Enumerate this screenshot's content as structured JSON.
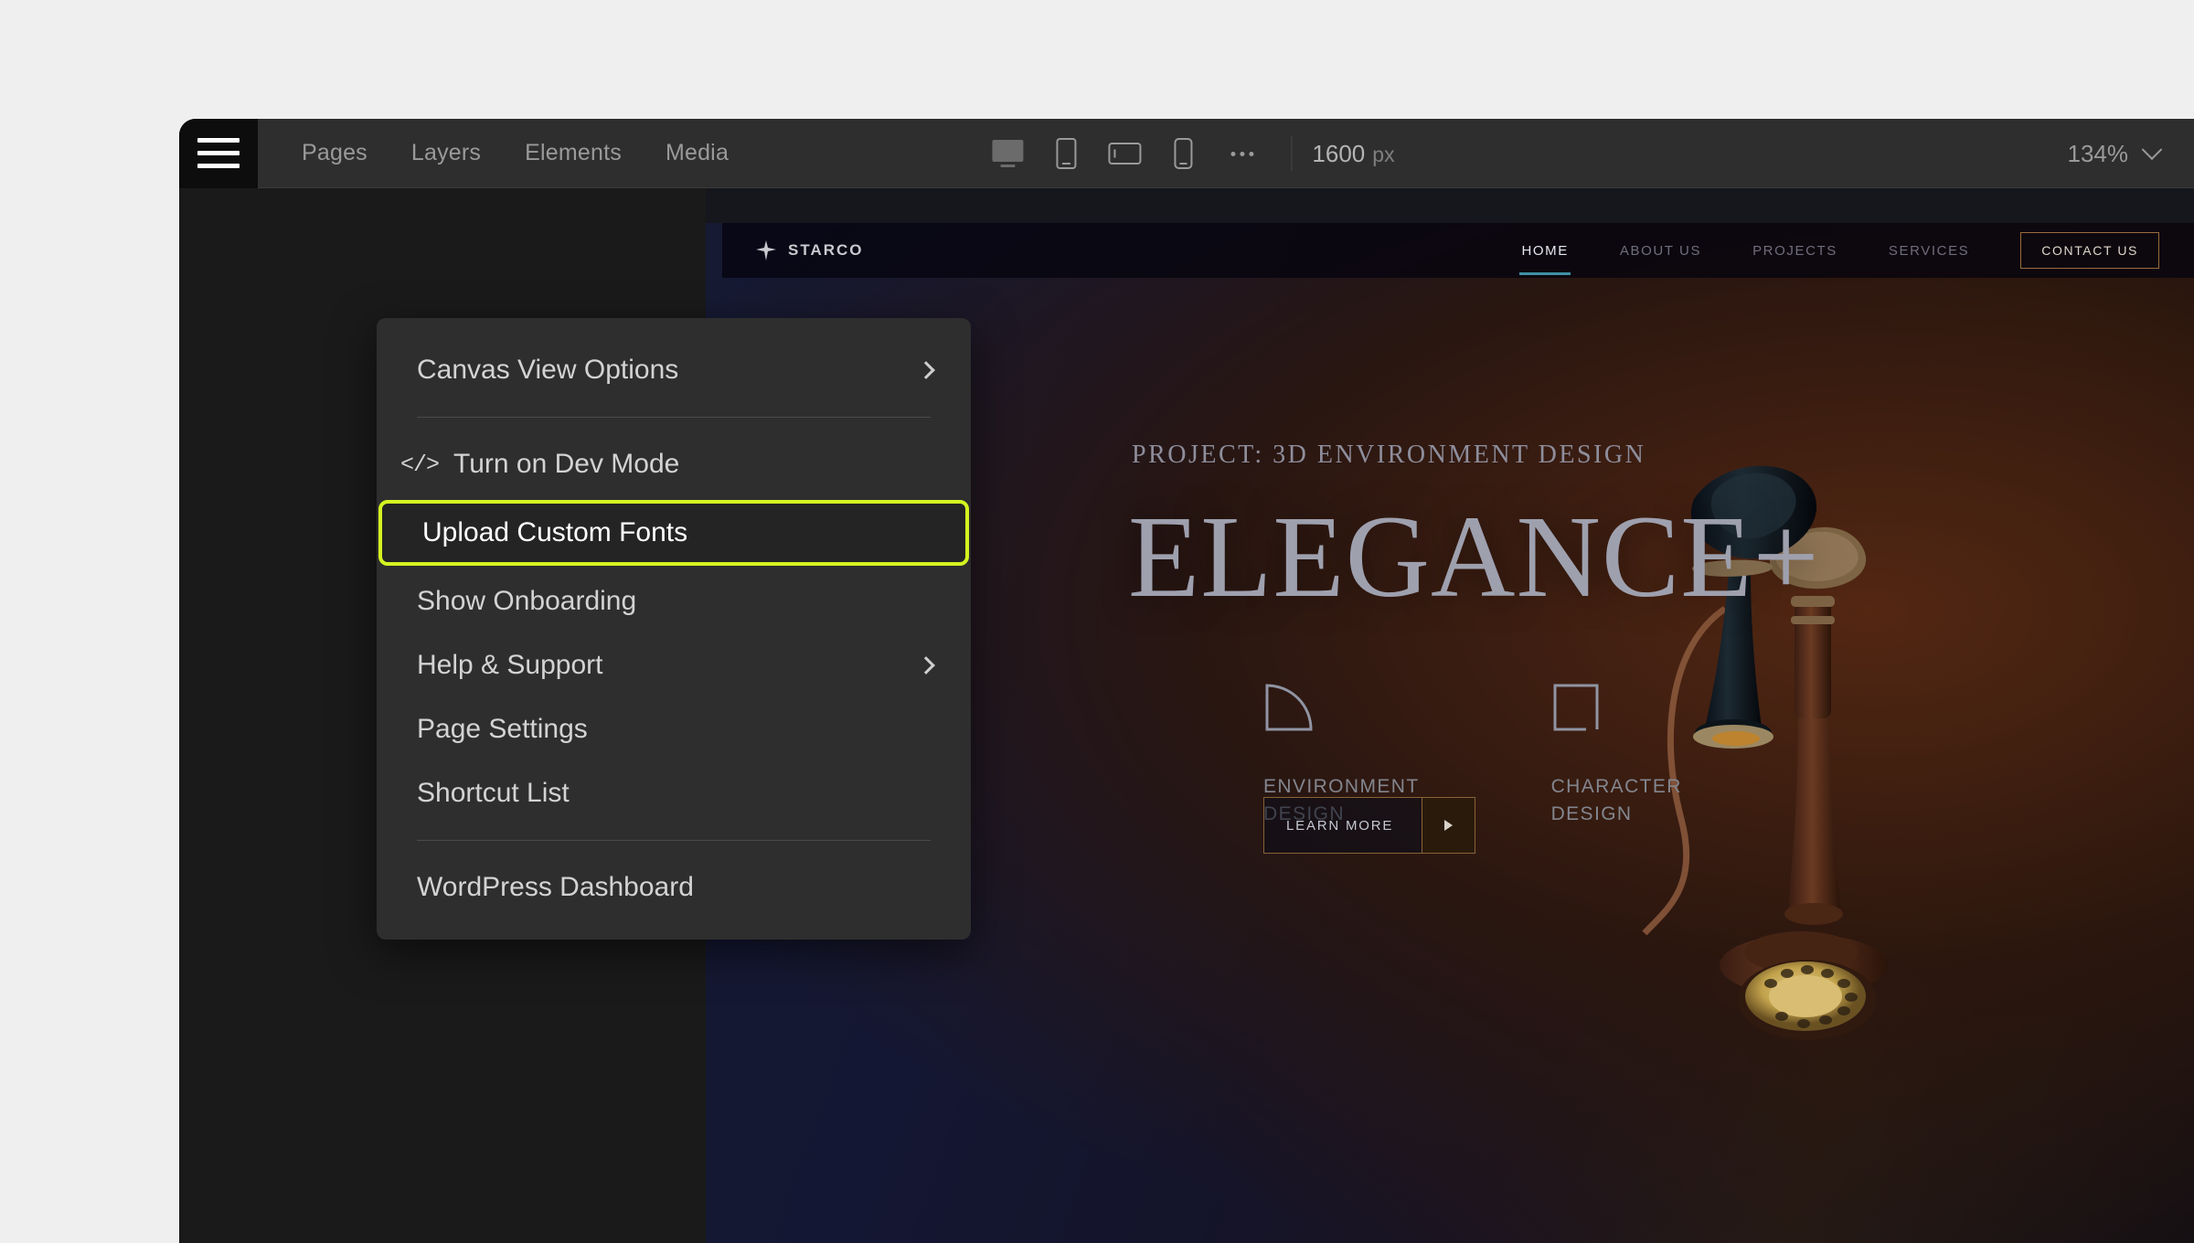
{
  "topbar": {
    "hamburger_icon": "hamburger-icon",
    "tabs": [
      {
        "label": "Pages"
      },
      {
        "label": "Layers"
      },
      {
        "label": "Elements"
      },
      {
        "label": "Media"
      }
    ],
    "devices": [
      {
        "name": "desktop",
        "icon": "desktop-icon",
        "active": true
      },
      {
        "name": "tablet-portrait",
        "icon": "tablet-portrait-icon",
        "active": false
      },
      {
        "name": "tablet-landscape",
        "icon": "tablet-landscape-icon",
        "active": false
      },
      {
        "name": "mobile",
        "icon": "mobile-icon",
        "active": false
      },
      {
        "name": "more-breakpoints",
        "icon": "ellipsis-icon",
        "active": false
      }
    ],
    "canvas_width": {
      "value": "1600",
      "unit": "px"
    },
    "zoom": {
      "value": "134%",
      "icon": "chevron-down-icon"
    }
  },
  "menu": {
    "items": [
      {
        "label": "Canvas View Options",
        "trailing_icon": "chevron-right-icon",
        "leading_icon": null,
        "highlighted": false
      },
      {
        "label": "Turn on Dev Mode",
        "trailing_icon": null,
        "leading_icon": "code-brackets-icon",
        "highlighted": false
      },
      {
        "label": "Upload Custom Fonts",
        "trailing_icon": null,
        "leading_icon": null,
        "highlighted": true
      },
      {
        "label": "Show Onboarding",
        "trailing_icon": null,
        "leading_icon": null,
        "highlighted": false
      },
      {
        "label": "Help & Support",
        "trailing_icon": "chevron-right-icon",
        "leading_icon": null,
        "highlighted": false
      },
      {
        "label": "Page Settings",
        "trailing_icon": null,
        "leading_icon": null,
        "highlighted": false
      },
      {
        "label": "Shortcut List",
        "trailing_icon": null,
        "leading_icon": null,
        "highlighted": false
      },
      {
        "label": "WordPress Dashboard",
        "trailing_icon": null,
        "leading_icon": null,
        "highlighted": false
      }
    ],
    "highlight_color": "#d4f520"
  },
  "canvas": {
    "site": {
      "brand": {
        "name": "STARCO",
        "icon": "star-logo-icon"
      },
      "nav_links": [
        {
          "label": "HOME",
          "active": true
        },
        {
          "label": "ABOUT US",
          "active": false
        },
        {
          "label": "PROJECTS",
          "active": false
        },
        {
          "label": "SERVICES",
          "active": false
        }
      ],
      "active_underline_color": "#3f8fa3",
      "contact_button": {
        "label": "CONTACT US",
        "border_color": "#9a6b3c"
      },
      "hero": {
        "kicker": "PROJECT: 3D ENVIRONMENT DESIGN",
        "title": "ELEGANCE+"
      },
      "features": [
        {
          "label": "ENVIRONMENT\nDESIGN",
          "icon": "quarter-circle-icon"
        },
        {
          "label": "CHARACTER\nDESIGN",
          "icon": "square-outline-icon"
        }
      ],
      "cta": {
        "label": "LEARN MORE",
        "icon": "arrow-right-icon"
      },
      "artwork": "vintage-candlestick-telephone"
    }
  }
}
